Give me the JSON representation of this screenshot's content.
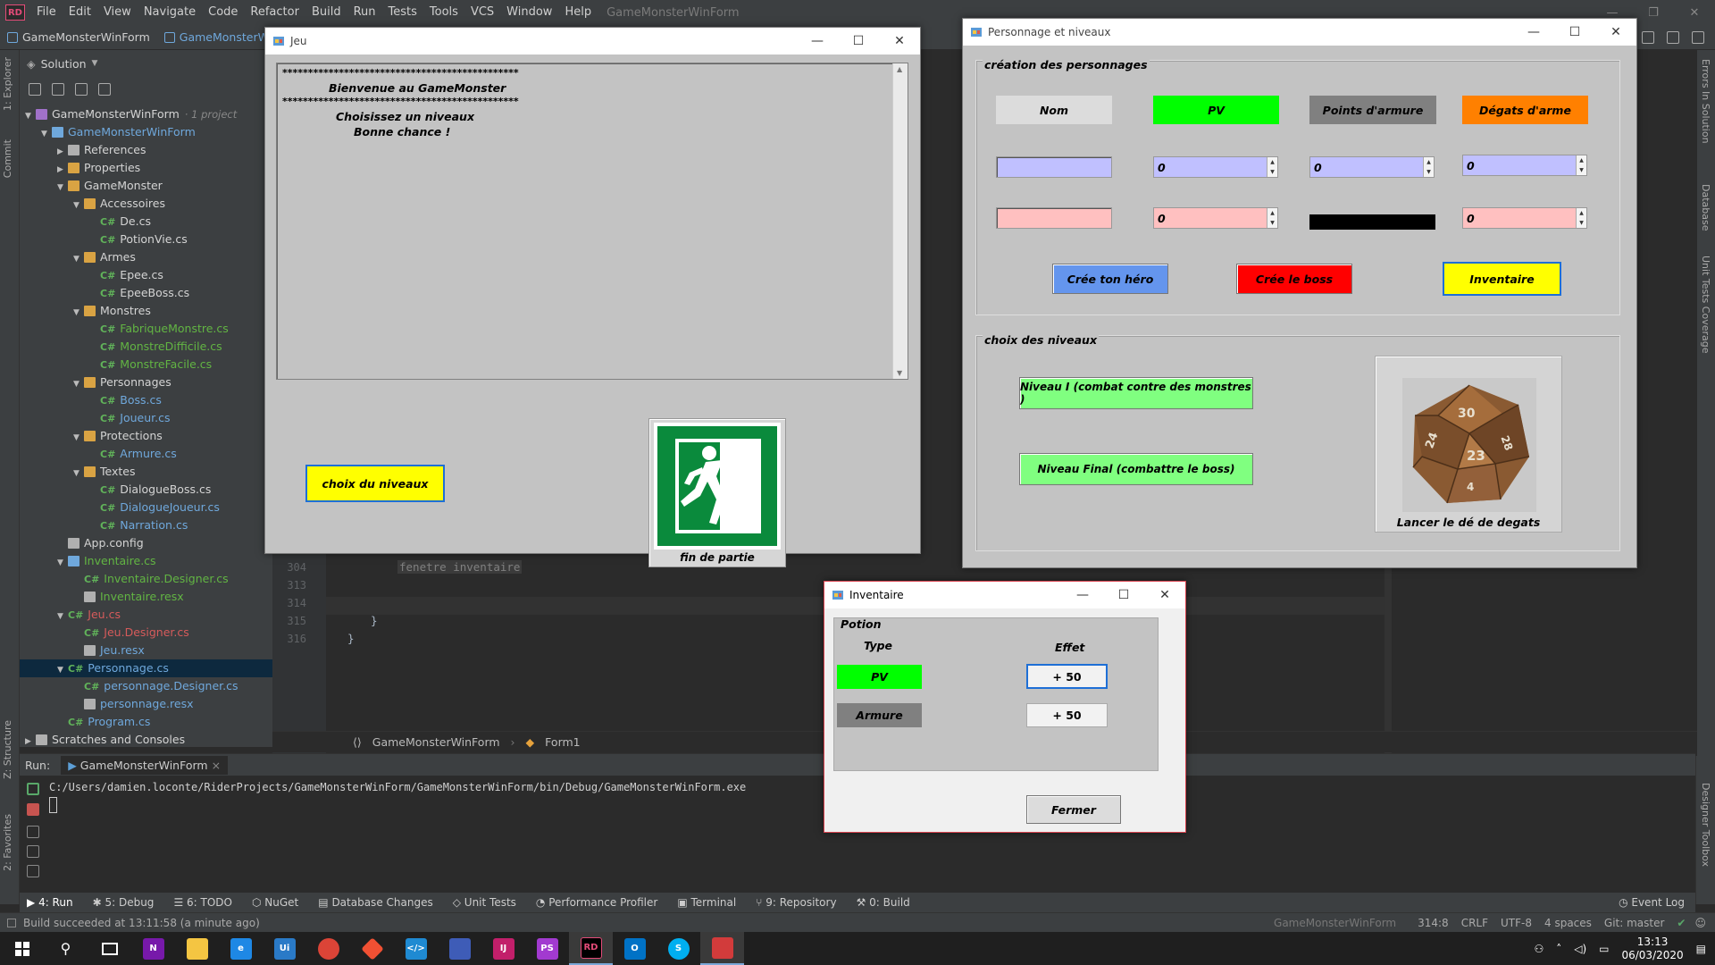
{
  "ide": {
    "logo": "RD",
    "menu": [
      "File",
      "Edit",
      "View",
      "Navigate",
      "Code",
      "Refactor",
      "Build",
      "Run",
      "Tests",
      "Tools",
      "VCS",
      "Window",
      "Help"
    ],
    "project_title": "GameMonsterWinForm",
    "breadcrumb": [
      "GameMonsterWinForm",
      "GameMonsterWinForm"
    ],
    "left_tabs": [
      "1: Explorer",
      "Commit",
      "Z: Structure",
      "2: Favorites"
    ],
    "right_tabs": [
      "Errors In Solution",
      "Database",
      "Unit Tests Coverage",
      "Designer Toolbox"
    ]
  },
  "solution": {
    "header": "Solution",
    "tree": [
      {
        "label": "GameMonsterWinForm",
        "extra": "· 1 project",
        "indent": 0,
        "arrow": "▼",
        "kind": "sln"
      },
      {
        "label": "GameMonsterWinForm",
        "indent": 1,
        "arrow": "▼",
        "kind": "proj",
        "color": "blue"
      },
      {
        "label": "References",
        "indent": 2,
        "arrow": "▶",
        "kind": "ref"
      },
      {
        "label": "Properties",
        "indent": 2,
        "arrow": "▶",
        "kind": "folder"
      },
      {
        "label": "GameMonster",
        "indent": 2,
        "arrow": "▼",
        "kind": "folder"
      },
      {
        "label": "Accessoires",
        "indent": 3,
        "arrow": "▼",
        "kind": "folder"
      },
      {
        "label": "De.cs",
        "indent": 4,
        "kind": "cs"
      },
      {
        "label": "PotionVie.cs",
        "indent": 4,
        "kind": "cs"
      },
      {
        "label": "Armes",
        "indent": 3,
        "arrow": "▼",
        "kind": "folder"
      },
      {
        "label": "Epee.cs",
        "indent": 4,
        "kind": "cs"
      },
      {
        "label": "EpeeBoss.cs",
        "indent": 4,
        "kind": "cs"
      },
      {
        "label": "Monstres",
        "indent": 3,
        "arrow": "▼",
        "kind": "folder"
      },
      {
        "label": "FabriqueMonstre.cs",
        "indent": 4,
        "kind": "cs",
        "color": "green"
      },
      {
        "label": "MonstreDifficile.cs",
        "indent": 4,
        "kind": "cs",
        "color": "green"
      },
      {
        "label": "MonstreFacile.cs",
        "indent": 4,
        "kind": "cs",
        "color": "green"
      },
      {
        "label": "Personnages",
        "indent": 3,
        "arrow": "▼",
        "kind": "folder"
      },
      {
        "label": "Boss.cs",
        "indent": 4,
        "kind": "cs",
        "color": "blue"
      },
      {
        "label": "Joueur.cs",
        "indent": 4,
        "kind": "cs",
        "color": "blue"
      },
      {
        "label": "Protections",
        "indent": 3,
        "arrow": "▼",
        "kind": "folder"
      },
      {
        "label": "Armure.cs",
        "indent": 4,
        "kind": "cs",
        "color": "blue"
      },
      {
        "label": "Textes",
        "indent": 3,
        "arrow": "▼",
        "kind": "folder"
      },
      {
        "label": "DialogueBoss.cs",
        "indent": 4,
        "kind": "cs"
      },
      {
        "label": "DialogueJoueur.cs",
        "indent": 4,
        "kind": "cs",
        "color": "blue"
      },
      {
        "label": "Narration.cs",
        "indent": 4,
        "kind": "cs",
        "color": "blue"
      },
      {
        "label": "App.config",
        "indent": 2,
        "kind": "cfg"
      },
      {
        "label": "Inventaire.cs",
        "indent": 2,
        "arrow": "▼",
        "kind": "form",
        "color": "green"
      },
      {
        "label": "Inventaire.Designer.cs",
        "indent": 3,
        "kind": "cs",
        "color": "green"
      },
      {
        "label": "Inventaire.resx",
        "indent": 3,
        "kind": "resx",
        "color": "green"
      },
      {
        "label": "Jeu.cs",
        "indent": 2,
        "arrow": "▼",
        "kind": "cs",
        "color": "red"
      },
      {
        "label": "Jeu.Designer.cs",
        "indent": 3,
        "kind": "cs",
        "color": "red"
      },
      {
        "label": "Jeu.resx",
        "indent": 3,
        "kind": "resx",
        "color": "blue"
      },
      {
        "label": "Personnage.cs",
        "indent": 2,
        "arrow": "▼",
        "kind": "cs",
        "color": "blue",
        "selected": true
      },
      {
        "label": "personnage.Designer.cs",
        "indent": 3,
        "kind": "cs",
        "color": "blue"
      },
      {
        "label": "personnage.resx",
        "indent": 3,
        "kind": "resx",
        "color": "blue"
      },
      {
        "label": "Program.cs",
        "indent": 2,
        "kind": "cs",
        "color": "blue"
      },
      {
        "label": "Scratches and Consoles",
        "indent": 0,
        "arrow": "▶",
        "kind": "scratch"
      }
    ]
  },
  "editor": {
    "lines": [
      {
        "num": "304",
        "text": "fenetre inventaire"
      },
      {
        "num": "313",
        "text": ""
      },
      {
        "num": "314",
        "text": ""
      },
      {
        "num": "315",
        "text": "}"
      },
      {
        "num": "316",
        "text": "}"
      }
    ],
    "breadcrumb": [
      "GameMonsterWinForm",
      "Form1"
    ]
  },
  "run": {
    "label": "Run:",
    "tab": "GameMonsterWinForm",
    "path": "C:/Users/damien.loconte/RiderProjects/GameMonsterWinForm/GameMonsterWinForm/bin/Debug/GameMonsterWinForm.exe"
  },
  "tool_buttons": [
    "4: Run",
    "5: Debug",
    "6: TODO",
    "NuGet",
    "Database Changes",
    "Unit Tests",
    "Performance Profiler",
    "Terminal",
    "9: Repository",
    "0: Build"
  ],
  "event_log": "Event Log",
  "status": {
    "message": "Build succeeded at 13:11:58 (a minute ago)",
    "project": "GameMonsterWinForm",
    "position": "314:8",
    "line_ending": "CRLF",
    "encoding": "UTF-8",
    "indent": "4 spaces",
    "git": "Git: master"
  },
  "taskbar": {
    "time": "13:13",
    "date": "06/03/2020"
  },
  "jeu": {
    "title": "Jeu",
    "stars": "**********************************************",
    "welcome": "Bienvenue au GameMonster",
    "line_choose": "Choisissez un niveaux",
    "line_luck": "Bonne chance !",
    "choix_button": "choix du niveaux",
    "fin_label": "fin de partie"
  },
  "perso": {
    "title": "Personnage et niveaux",
    "group_creation": "création des personnages",
    "headers": {
      "nom": "Nom",
      "pv": "PV",
      "armure": "Points d'armure",
      "degats": "Dégats d'arme"
    },
    "hero_values": {
      "pv": "0",
      "armure": "0",
      "degats": "0"
    },
    "boss_values": {
      "pv": "0",
      "degats": "0"
    },
    "btn_hero": "Crée ton héro",
    "btn_boss": "Crée le boss",
    "btn_inventaire": "Inventaire",
    "group_niveaux": "choix des niveaux",
    "niveau1": "Niveau I (combat contre des monstres )",
    "niveau_final": "Niveau Final (combattre le boss)",
    "dice_label": "Lancer le dé de degats",
    "dice_numbers": [
      "30",
      "24",
      "23",
      "28",
      "4"
    ]
  },
  "inventaire": {
    "title": "Inventaire",
    "group_label": "Potion",
    "col_type": "Type",
    "col_effet": "Effet",
    "rows": [
      {
        "type": "PV",
        "effet": "+ 50"
      },
      {
        "type": "Armure",
        "effet": "+ 50"
      }
    ],
    "close_button": "Fermer"
  },
  "colors": {
    "pv_green": "#00ff00",
    "armor_gray": "#808080",
    "orange": "#ff8000",
    "yellow": "#ffff00",
    "red": "#ff0000",
    "blue_btn": "#6495ed",
    "lavender": "#c0c0ff",
    "pink": "#ffc0c0"
  }
}
